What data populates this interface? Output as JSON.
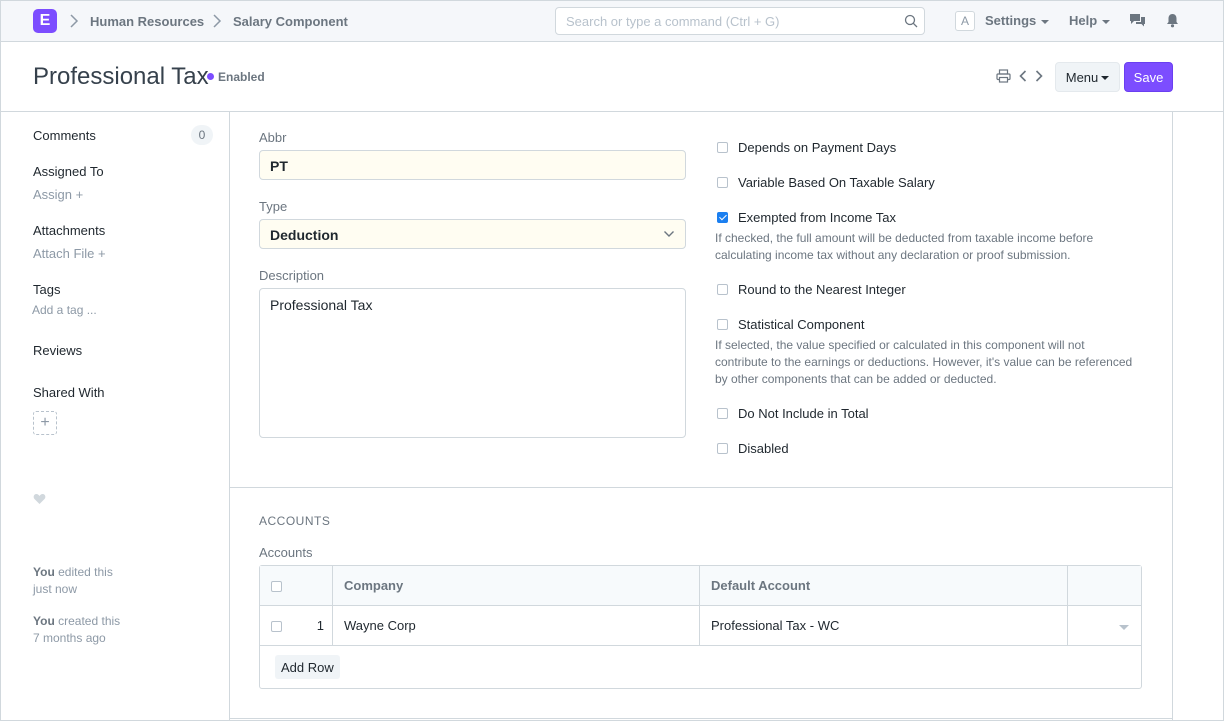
{
  "navbar": {
    "logo": "E",
    "breadcrumbs": [
      "Human Resources",
      "Salary Component"
    ],
    "search_placeholder": "Search or type a command (Ctrl + G)",
    "avatar": "A",
    "settings_label": "Settings",
    "help_label": "Help"
  },
  "header": {
    "title": "Professional Tax",
    "status": "Enabled",
    "menu_label": "Menu",
    "save_label": "Save"
  },
  "sidebar": {
    "comments_label": "Comments",
    "comments_count": "0",
    "assigned_to_label": "Assigned To",
    "assign_link": "Assign +",
    "attachments_label": "Attachments",
    "attach_link": "Attach File +",
    "tags_label": "Tags",
    "tags_link": "Add a tag ...",
    "reviews_label": "Reviews",
    "shared_with_label": "Shared With",
    "share_add": "+",
    "activity": [
      {
        "who": "You",
        "action": "edited this",
        "when": "just now"
      },
      {
        "who": "You",
        "action": "created this",
        "when": "7 months ago"
      }
    ]
  },
  "form": {
    "abbr_label": "Abbr",
    "abbr_value": "PT",
    "type_label": "Type",
    "type_value": "Deduction",
    "description_label": "Description",
    "description_value": "Professional Tax",
    "checkboxes": [
      {
        "label": "Depends on Payment Days",
        "checked": false
      },
      {
        "label": "Variable Based On Taxable Salary",
        "checked": false
      },
      {
        "label": "Exempted from Income Tax",
        "checked": true,
        "desc": "If checked, the full amount will be deducted from taxable income before calculating income tax without any declaration or proof submission."
      },
      {
        "label": "Round to the Nearest Integer",
        "checked": false
      },
      {
        "label": "Statistical Component",
        "checked": false,
        "desc": "If selected, the value specified or calculated in this component will not contribute to the earnings or deductions. However, it's value can be referenced by other components that can be added or deducted."
      },
      {
        "label": "Do Not Include in Total",
        "checked": false
      },
      {
        "label": "Disabled",
        "checked": false
      }
    ]
  },
  "accounts": {
    "section_title": "ACCOUNTS",
    "table_label": "Accounts",
    "columns": [
      "Company",
      "Default Account"
    ],
    "rows": [
      {
        "idx": "1",
        "company": "Wayne Corp",
        "default_account": "Professional Tax - WC"
      }
    ],
    "add_row_label": "Add Row"
  }
}
